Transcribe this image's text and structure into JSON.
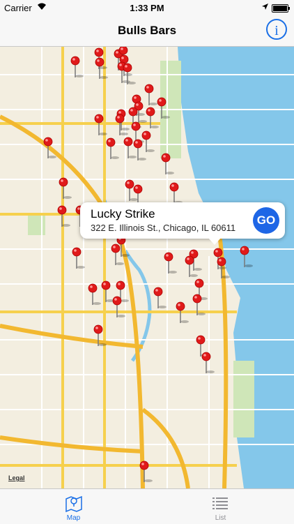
{
  "status_bar": {
    "carrier": "Carrier",
    "time": "1:33 PM"
  },
  "nav": {
    "title": "Bulls Bars",
    "info_icon": "info-icon",
    "info_label": "i"
  },
  "map": {
    "legal_label": "Legal",
    "water_color": "#84c7ea",
    "land_color": "#f3eee0",
    "pin_color": "#e01a1a"
  },
  "callout": {
    "name": "Lucky Strike",
    "address": "322 E. Illinois St., Chicago, IL 60611",
    "go_label": "GO"
  },
  "tabs": [
    {
      "label": "Map",
      "icon": "map-icon",
      "active": true
    },
    {
      "label": "List",
      "icon": "list-icon",
      "active": false
    }
  ],
  "colors": {
    "accent": "#1a6fe6",
    "go_button": "#1e66e6"
  }
}
